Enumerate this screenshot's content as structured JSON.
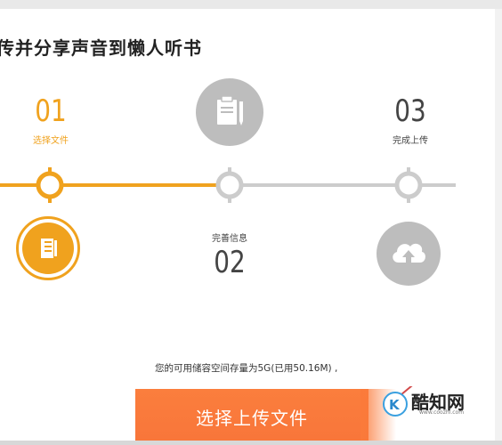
{
  "title": "传并分享声音到懒人听书",
  "steps": [
    {
      "number": "01",
      "label": "选择文件",
      "state": "active"
    },
    {
      "number": "02",
      "label": "完善信息",
      "state": "pending"
    },
    {
      "number": "03",
      "label": "完成上传",
      "state": "pending"
    }
  ],
  "storage": {
    "text": "您的可用储容空间存量为5G(已用50.16M) ,"
  },
  "upload_button": {
    "label": "选择上传文件"
  },
  "watermark": {
    "brand": "酷知网",
    "url": "www.coozhi.com"
  },
  "colors": {
    "active": "#f0a21e",
    "inactive": "#cccccc",
    "button": "#fb7a3a"
  },
  "icons": {
    "step1": "document-folder-icon",
    "step2": "clipboard-pen-icon",
    "step3": "cloud-upload-icon"
  }
}
